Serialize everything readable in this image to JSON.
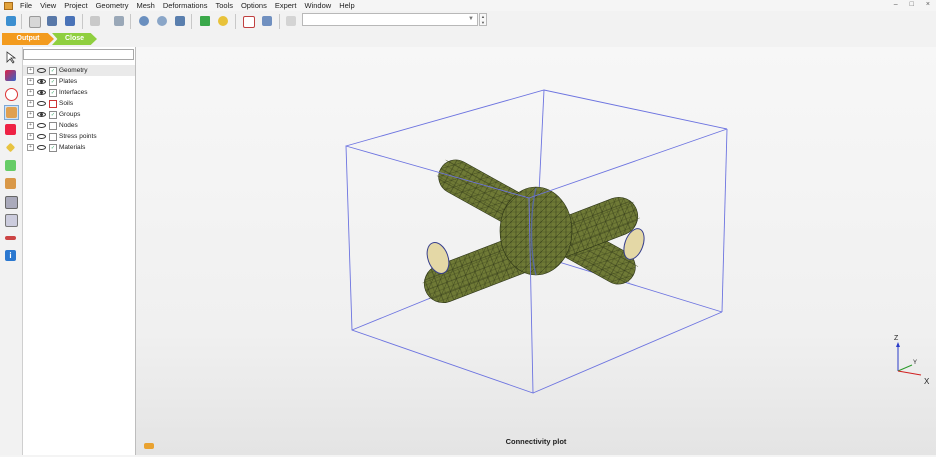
{
  "menu": [
    "File",
    "View",
    "Project",
    "Geometry",
    "Mesh",
    "Deformations",
    "Tools",
    "Options",
    "Expert",
    "Window",
    "Help"
  ],
  "window_controls": [
    "–",
    "□",
    "×"
  ],
  "tabs": {
    "output": "Output",
    "close": "Close"
  },
  "tree": [
    {
      "label": "Geometry",
      "eye": "closed",
      "selected": true
    },
    {
      "label": "Plates",
      "eye": "open"
    },
    {
      "label": "Interfaces",
      "eye": "open"
    },
    {
      "label": "Soils",
      "eye": "closed"
    },
    {
      "label": "Groups",
      "eye": "open"
    },
    {
      "label": "Nodes",
      "eye": "closed"
    },
    {
      "label": "Stress points",
      "eye": "closed"
    },
    {
      "label": "Materials",
      "eye": "closed"
    }
  ],
  "axes": {
    "z": "Z",
    "y": "Y",
    "x": "X"
  },
  "status": "Connectivity plot",
  "colors": {
    "mesh_fill": "#6f7a36",
    "mesh_line": "#2b3315",
    "box": "#6d74e0",
    "tab_output": "#f39b1e",
    "tab_close": "#8fcf3f"
  },
  "toolbar_icons": [
    "new-project-icon",
    "copy-icon",
    "print-icon",
    "export-icon",
    "zoom-window-icon",
    "pan-icon",
    "zoom-in-icon",
    "zoom-out-icon",
    "reset-view-icon",
    "add-icon",
    "light-icon",
    "scale-icon",
    "table-icon",
    "list-icon"
  ]
}
